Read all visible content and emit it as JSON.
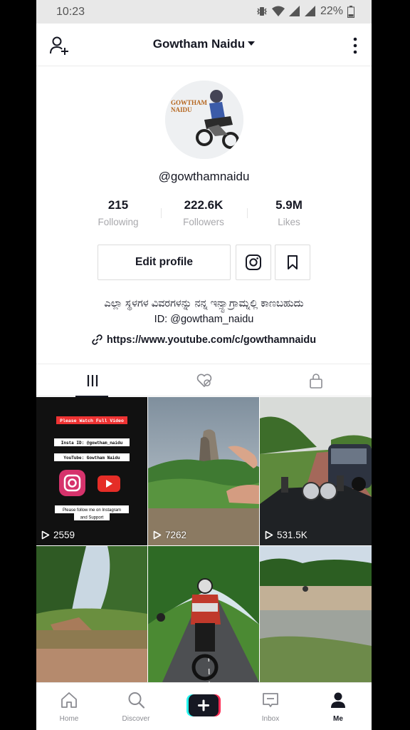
{
  "status_bar": {
    "time": "10:23",
    "battery": "22%"
  },
  "header": {
    "title": "Gowtham Naidu"
  },
  "avatar": {
    "logo_line1": "GOWTHAM",
    "logo_line2": "NAIDU"
  },
  "profile": {
    "username": "@gowthamnaidu",
    "stats": [
      {
        "value": "215",
        "label": "Following"
      },
      {
        "value": "222.6K",
        "label": "Followers"
      },
      {
        "value": "5.9M",
        "label": "Likes"
      }
    ],
    "edit_label": "Edit profile",
    "bio": "ಎಲ್ಲಾ ಸ್ಥಳಗಳ ವಿವರಗಳನ್ನು ನನ್ನ ಇನ್ಸ್ಟಾಗ್ರಾಮ್ನಲ್ಲಿ ಕಾಣಬಹುದು",
    "bio_id": "ID: @gowtham_naidu",
    "link": "https://www.youtube.com/c/gowthamnaidu"
  },
  "videos": [
    {
      "views": "2559",
      "overlay": {
        "banner": "Please Watch Full Video",
        "insta": "Insta ID: @gowtham_naidu",
        "youtube": "YouTube: Gowtham Naidu",
        "follow_line1": "Please follow me on Instagram",
        "follow_line2": "and Support"
      }
    },
    {
      "views": "7262"
    },
    {
      "views": "531.5K"
    },
    {
      "views": ""
    },
    {
      "views": ""
    },
    {
      "views": ""
    }
  ],
  "nav": {
    "items": [
      {
        "label": "Home"
      },
      {
        "label": "Discover"
      },
      {
        "label": "Inbox"
      },
      {
        "label": "Me"
      }
    ]
  },
  "colors": {
    "accent_cyan": "#25f4ee",
    "accent_red": "#fe2c55",
    "text": "#161823",
    "muted": "#a8a8ac"
  }
}
